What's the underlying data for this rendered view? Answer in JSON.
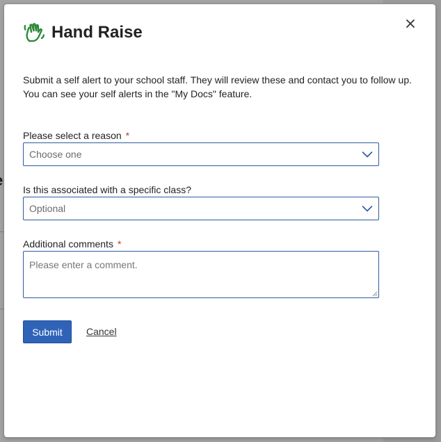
{
  "dialog": {
    "title": "Hand Raise",
    "description": "Submit a self alert to your school staff. They will review these and contact you to follow up. You can see your self alerts in the \"My Docs\" feature.",
    "close_label": "×"
  },
  "form": {
    "reason": {
      "label": "Please select a reason",
      "required_mark": "*",
      "selected": "Choose one"
    },
    "class": {
      "label": "Is this associated with a specific class?",
      "selected": "Optional"
    },
    "comments": {
      "label": "Additional comments",
      "required_mark": "*",
      "placeholder": "Please enter a comment."
    }
  },
  "actions": {
    "submit_label": "Submit",
    "cancel_label": "Cancel"
  },
  "colors": {
    "accent": "#2f63b8",
    "field_border": "#2c5aa0",
    "icon_green": "#2e8b3a",
    "required": "#c0392b"
  },
  "icons": {
    "title_icon": "hand-raise-icon",
    "close_icon": "close-icon",
    "dropdown_icon": "chevron-down-icon"
  }
}
